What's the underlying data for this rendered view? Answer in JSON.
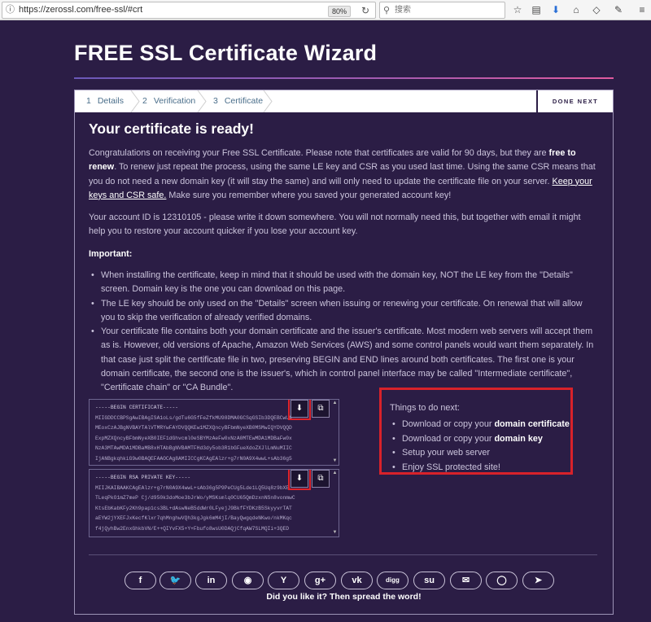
{
  "browser": {
    "url": "https://zerossl.com/free-ssl/#crt",
    "zoom": "80%",
    "search_placeholder": "搜索",
    "icons": [
      "info-icon",
      "reload-icon",
      "star-icon",
      "reader-icon",
      "download-icon",
      "home-icon",
      "pocket-icon",
      "extension-icon",
      "menu-icon"
    ]
  },
  "page": {
    "title": "FREE SSL Certificate Wizard"
  },
  "wizard": {
    "steps": [
      {
        "num": "1",
        "label": "Details"
      },
      {
        "num": "2",
        "label": "Verification"
      },
      {
        "num": "3",
        "label": "Certificate"
      }
    ],
    "done_next": "DONE NEXT",
    "heading": "Your certificate is ready!",
    "para1_a": "Congratulations on receiving your Free SSL Certificate. Please note that certificates are valid for 90 days, but they are ",
    "para1_b": "free to renew",
    "para1_c": ". To renew just repeat the process, using the same LE key and CSR as you used last time. Using the same CSR means that you do not need a new domain key (it will stay the same) and will only need to update the certificate file on your server. ",
    "para1_d": "Keep your keys and CSR safe.",
    "para1_e": " Make sure you remember where you saved your generated account key!",
    "para2": "Your account ID is 12310105 - please write it down somewhere. You will not normally need this, but together with email it might help you to restore your account quicker if you lose your account key.",
    "important_label": "Important:",
    "bullets": [
      "When installing the certificate, keep in mind that it should be used with the domain key, NOT the LE key from the \"Details\" screen. Domain key is the one you can download on this page.",
      "The LE key should be only used on the \"Details\" screen when issuing or renewing your certificate. On renewal that will allow you to skip the verification of already verified domains.",
      "Your certificate file contains both your domain certificate and the issuer's certificate. Most modern web servers will accept them as is. However, old versions of Apache, Amazon Web Services (AWS) and some control panels would want them separately. In that case just split the certificate file in two, preserving BEGIN and END lines around both certificates. The first one is your domain certificate, the second one is the issuer's, which in control panel interface may be called \"Intermediate certificate\", \"Certificate chain\" or \"CA Bundle\"."
    ],
    "cert_box": {
      "lines": [
        "-----BEGIN CERTIFICATE-----",
        "MIIGDDCCBPSgAwIBAgISA1oLs/gdTu6G5fFeZfkMU98DMA0GCSqGSIb3DQEBCwUA",
        "MEoxCzAJBgNVBAYTAlVTMRYwFAYDVQQKEw1MZXQncyBFbmNyeXB0MSMwIQYDVQQD",
        "ExpMZXQncyBFbmNyeXB0IEF1dGhvcml0eSBYMzAeFw0xNzA0MTEwMDA1MDBaFw0x",
        "NzA3MTAwMDA1MDBaMB8xHTAbBgNVBAMTFHd3dy5ob3R1bGFueXdoZXJlLmNuMIIC",
        "IjANBgkqhkiG9w0BAQEFAAOCAg8AMIICCgKCAgEAlzr+g7rN0A9X4wwL+sAb36g5"
      ]
    },
    "key_box": {
      "lines": [
        "-----BEGIN RSA PRIVATE KEY-----",
        "MIIJKAIBAAKCAgEAlzr+g7rN0A9X4wwL+sAb36g5P9PeCUg5Lde1LQ5Uq8z9bXE",
        "TLeqPkO1mZ7meP Cj/d950k3doMoe3bJrWo/yMSKsmlq0CU65QmDzxnNSn8vonmwC",
        "KtsEbKabKFy2Kh9pap1cs3BL+dAswNeB5ddWr0LFyejJ9BkfFYDKzB5SkyyvrTAT",
        "aEYW2jYXEFJxKecfKlxr7qhMnghwVQh3kgJgk6mM4jI/BayQwgqdeNKwo/nkMKqc",
        "f4jQyhBw2EnxGhkbVN/E++QIYvFX5+Y+Fbufo8wsU0DAQjCfqAW7SLMQIi+3QED"
      ]
    },
    "todo": {
      "title": "Things to do next:",
      "items": [
        {
          "pre": "Download or copy your ",
          "bold": "domain certificate"
        },
        {
          "pre": "Download or copy your ",
          "bold": "domain key"
        },
        {
          "pre": "Setup your web server",
          "bold": ""
        },
        {
          "pre": "Enjoy SSL protected site!",
          "bold": ""
        }
      ]
    },
    "share": {
      "buttons": [
        {
          "name": "facebook",
          "glyph": "f"
        },
        {
          "name": "twitter",
          "glyph": "🐦"
        },
        {
          "name": "linkedin",
          "glyph": "in"
        },
        {
          "name": "reddit",
          "glyph": "◉"
        },
        {
          "name": "yahoo",
          "glyph": "Y"
        },
        {
          "name": "googleplus",
          "glyph": "g+"
        },
        {
          "name": "vk",
          "glyph": "vk"
        },
        {
          "name": "digg",
          "glyph": "digg"
        },
        {
          "name": "stumbleupon",
          "glyph": "su"
        },
        {
          "name": "email",
          "glyph": "✉"
        },
        {
          "name": "whatsapp",
          "glyph": "◯"
        },
        {
          "name": "telegram",
          "glyph": "➤"
        }
      ],
      "caption": "Did you like it? Then spread the word!"
    }
  },
  "colors": {
    "background": "#2b1d45",
    "accent_red": "#d8222a",
    "step_text": "#4a6e8a"
  }
}
